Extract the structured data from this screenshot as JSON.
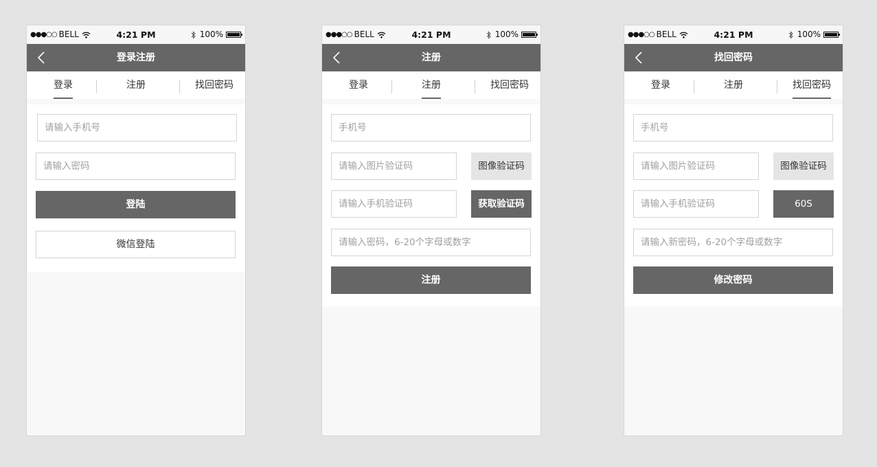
{
  "status": {
    "signal": "●●●○○",
    "carrier": "BELL",
    "time": "4:21 PM",
    "battery": "100%"
  },
  "tabs": [
    "登录",
    "注册",
    "找回密码"
  ],
  "screens": [
    {
      "title": "登录注册",
      "active_tab": 0,
      "phone_placeholder": "请输入手机号",
      "password_placeholder": "请输入密码",
      "login_button": "登陆",
      "wechat_button": "微信登陆"
    },
    {
      "title": "注册",
      "active_tab": 1,
      "phone_placeholder": "手机号",
      "image_code_placeholder": "请输入图片验证码",
      "image_code_button": "图像验证码",
      "sms_code_placeholder": "请输入手机验证码",
      "sms_code_button": "获取验证码",
      "password_placeholder": "请输入密码，6-20个字母或数字",
      "submit_button": "注册"
    },
    {
      "title": "找回密码",
      "active_tab": 2,
      "phone_placeholder": "手机号",
      "image_code_placeholder": "请输入图片验证码",
      "image_code_button": "图像验证码",
      "sms_code_placeholder": "请输入手机验证码",
      "sms_code_button": "60S",
      "password_placeholder": "请输入新密码，6-20个字母或数字",
      "submit_button": "修改密码"
    }
  ]
}
